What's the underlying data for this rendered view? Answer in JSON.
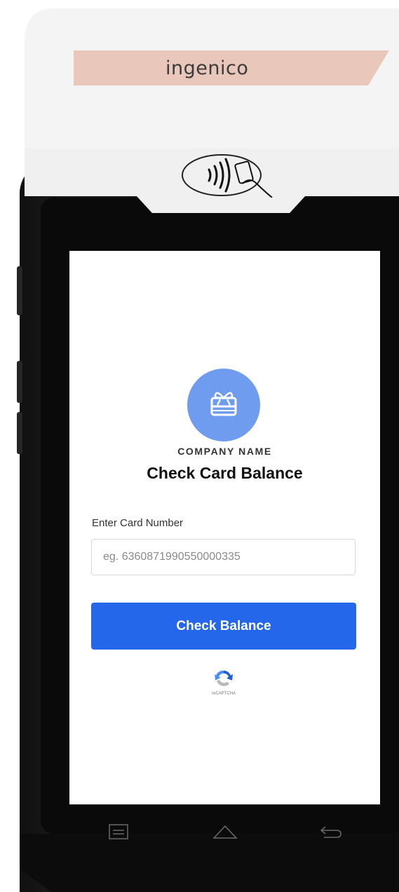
{
  "device": {
    "brand": "ingenico",
    "colors": {
      "body": "#151515",
      "cap": "#f4f4f4",
      "brand_strip": "#e9c8bb"
    },
    "contactless_icon": "contactless-tap-icon"
  },
  "screen": {
    "gift_icon": "gift-card-icon",
    "company_name": "COMPANY NAME",
    "title": "Check Card Balance",
    "card_field": {
      "label": "Enter Card Number",
      "value": "",
      "placeholder": "eg. 6360871990550000335"
    },
    "check_button_label": "Check Balance",
    "recaptcha": {
      "icon": "recaptcha-icon",
      "label": "reCAPTCHA"
    },
    "colors": {
      "accent": "#2567ea",
      "icon_circle": "#6f9cee"
    }
  },
  "navbar": {
    "icons": [
      "menu-icon",
      "home-icon",
      "back-icon"
    ]
  }
}
